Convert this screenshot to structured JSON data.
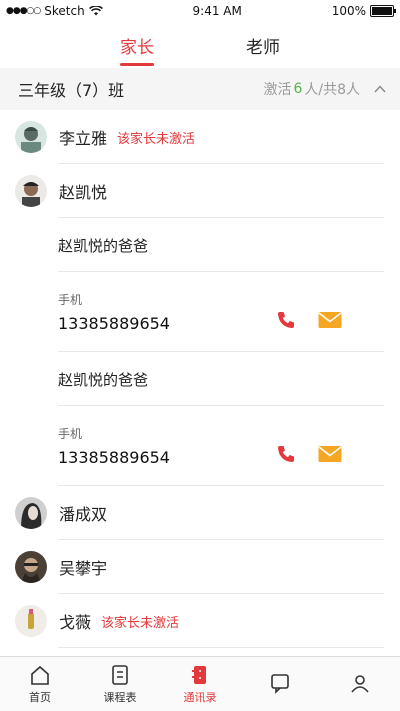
{
  "status_bar": {
    "carrier": "Sketch",
    "time": "9:41 AM",
    "battery": "100%"
  },
  "tabs": [
    {
      "label": "家长"
    },
    {
      "label": "老师"
    }
  ],
  "class_header": {
    "title": "三年级（7）班",
    "stats_prefix": "激活",
    "active_count": "6",
    "stats_suffix": "人/共8人"
  },
  "people": [
    {
      "name": "李立雅",
      "status": "该家长未激活"
    },
    {
      "name": "赵凯悦"
    },
    {
      "name": "潘成双"
    },
    {
      "name": "吴攀宇"
    },
    {
      "name": "戈薇",
      "status": "该家长未激活"
    }
  ],
  "guardians": [
    {
      "name": "赵凯悦的爸爸",
      "phone_label": "手机",
      "phone": "13385889654"
    },
    {
      "name": "赵凯悦的爸爸",
      "phone_label": "手机",
      "phone": "13385889654"
    }
  ],
  "tab_bar": [
    {
      "label": "首页",
      "icon": "home-icon"
    },
    {
      "label": "课程表",
      "icon": "schedule-icon"
    },
    {
      "label": "通讯录",
      "icon": "contacts-icon"
    },
    {
      "label": "",
      "icon": "message-icon"
    },
    {
      "label": "",
      "icon": "profile-icon"
    }
  ],
  "colors": {
    "accent": "#e4393c",
    "active_green": "#56b24a",
    "mail": "#f5a623",
    "phone": "#e4393c"
  }
}
